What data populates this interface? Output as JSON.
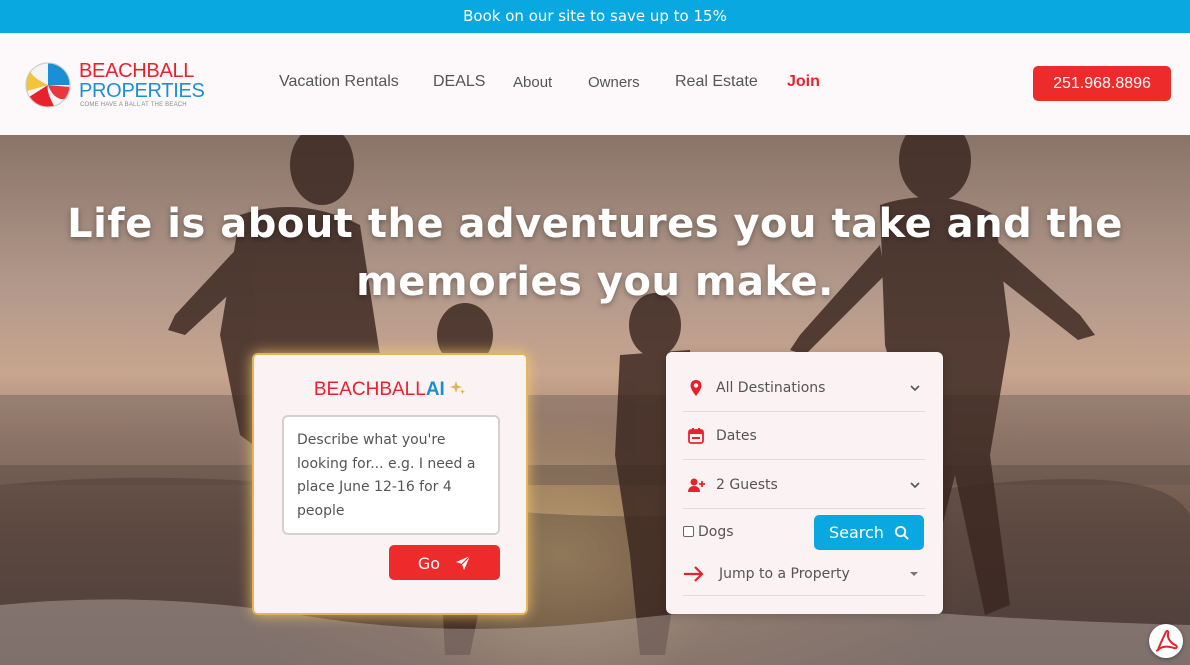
{
  "promo_banner": {
    "text": "Book on our site to save up to 15%"
  },
  "logo": {
    "line1": "BEACHBALL",
    "line2": "PROPERTIES",
    "tagline": "COME HAVE A BALL AT THE BEACH",
    "icon": "beach-ball-icon"
  },
  "nav": {
    "items": [
      {
        "label": "Vacation Rentals"
      },
      {
        "label": "DEALS"
      },
      {
        "label": "About"
      },
      {
        "label": "Owners"
      },
      {
        "label": "Real Estate"
      },
      {
        "label": "Join"
      }
    ]
  },
  "header": {
    "phone": "251.968.8896"
  },
  "hero": {
    "headline": "Life is about the adventures you take and the memories you make."
  },
  "ai_card": {
    "title_brand": "BEACHBALL",
    "title_ai": "AI",
    "sparkle_icon": "sparkle-icon",
    "placeholder": "Describe what you're looking for... e.g. I need a place June 12-16 for 4 people",
    "go_label": "Go",
    "go_icon": "send-icon"
  },
  "search_card": {
    "destination": "All Destinations",
    "dates": "Dates",
    "guests": "2 Guests",
    "dogs_label": "Dogs",
    "dogs_checked": false,
    "search_label": "Search",
    "jump_label": "Jump to a Property"
  },
  "colors": {
    "brand_red": "#ee2b2b",
    "brand_blue": "#0aa8e0",
    "accent_gold": "#e3b45a"
  }
}
